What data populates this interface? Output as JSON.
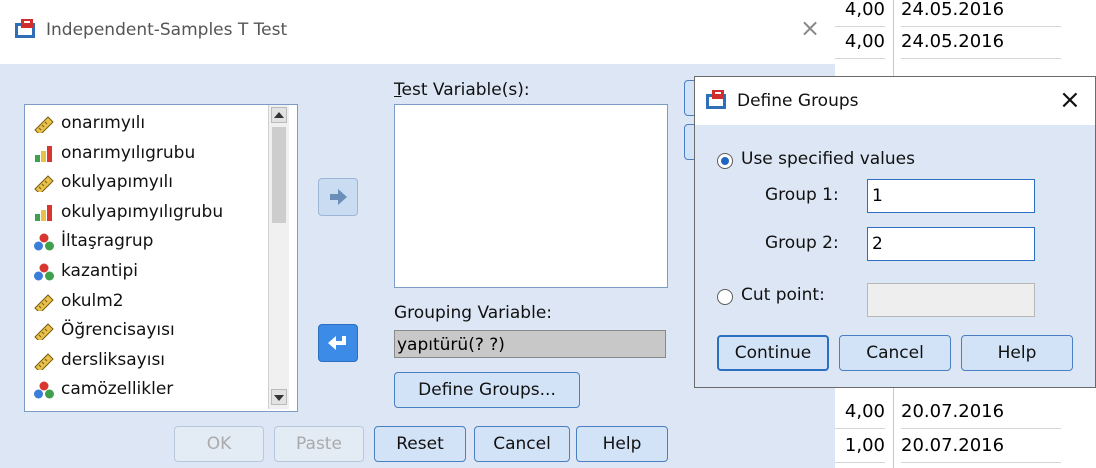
{
  "main_dialog": {
    "title": "Independent-Samples T Test",
    "close_symbol": "×",
    "variables": [
      {
        "label": "onarımyılı",
        "icon": "ruler-icon"
      },
      {
        "label": "onarımyılıgrubu",
        "icon": "bar-chart-icon"
      },
      {
        "label": "okulyapımyılı",
        "icon": "ruler-icon"
      },
      {
        "label": "okulyapımyılıgrubu",
        "icon": "bar-chart-icon"
      },
      {
        "label": "İltaşragrup",
        "icon": "nominal-icon"
      },
      {
        "label": "kazantipi",
        "icon": "nominal-icon"
      },
      {
        "label": "okulm2",
        "icon": "ruler-icon"
      },
      {
        "label": "Öğrencisayısı",
        "icon": "ruler-icon"
      },
      {
        "label": "dersliksayısı",
        "icon": "ruler-icon"
      },
      {
        "label": "camözellikler",
        "icon": "nominal-icon"
      }
    ],
    "test_variables_label": "Test Variable(s):",
    "grouping_variable_label": "Grouping Variable:",
    "grouping_variable_value": "yapıtürü(? ?)",
    "define_groups_label": "Define Groups...",
    "buttons": {
      "ok": "OK",
      "paste": "Paste",
      "reset": "Reset",
      "cancel": "Cancel",
      "help": "Help"
    }
  },
  "define_groups_dialog": {
    "title": "Define Groups",
    "close_symbol": "×",
    "use_specified_values_label": "Use specified values",
    "group1_label": "Group 1:",
    "group1_value": "1",
    "group2_label": "Group 2:",
    "group2_value": "2",
    "cut_point_label": "Cut point:",
    "cut_point_value": "",
    "buttons": {
      "continue": "Continue",
      "cancel": "Cancel",
      "help": "Help"
    }
  },
  "datasheet_rows_top": [
    {
      "value": "4,00",
      "date": "24.05.2016"
    },
    {
      "value": "4,00",
      "date": "24.05.2016"
    }
  ],
  "datasheet_rows_bottom": [
    {
      "value": "4,00",
      "date": "20.07.2016"
    },
    {
      "value": "1,00",
      "date": "20.07.2016"
    }
  ],
  "colors": {
    "accent": "#2066c4",
    "dialog_bg": "#dce6f4",
    "button_bg": "#d2e3f7"
  }
}
